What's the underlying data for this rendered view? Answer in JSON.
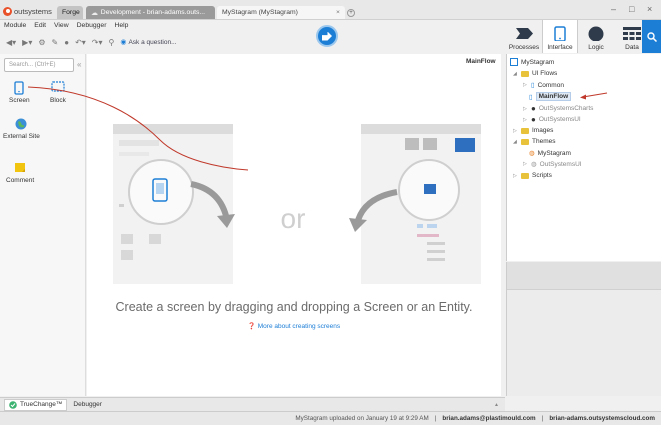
{
  "titlebar": {
    "brand": "outsystems",
    "tabs": [
      {
        "label": "Forge"
      },
      {
        "label": "Development - brian-adams.outs..."
      },
      {
        "label": "MyStagram (MyStagram)",
        "close": "×"
      }
    ],
    "add_tab": "+",
    "window_controls": {
      "minimize": "–",
      "maximize": "□",
      "close": "×"
    }
  },
  "menu": [
    "Module",
    "Edit",
    "View",
    "Debugger",
    "Help"
  ],
  "toolbar": {
    "ask": "Ask a question..."
  },
  "right_tabs": [
    {
      "label": "Processes",
      "icon": "processes-icon"
    },
    {
      "label": "Interface",
      "icon": "interface-icon",
      "active": true
    },
    {
      "label": "Logic",
      "icon": "logic-icon"
    },
    {
      "label": "Data",
      "icon": "data-icon"
    }
  ],
  "left_panel": {
    "search_placeholder": "Search... (Ctrl+E)",
    "widgets": [
      "Screen",
      "Block",
      "External Site",
      "Comment"
    ]
  },
  "canvas": {
    "flow_name": "MainFlow",
    "or_text": "or",
    "message": "Create a screen by dragging and dropping a Screen or an Entity.",
    "link": "More about creating screens"
  },
  "tree": {
    "root": "MyStagram",
    "ui_flows": "UI Flows",
    "common": "Common",
    "mainflow": "MainFlow",
    "charts": "OutSystemsCharts",
    "ui": "OutSystemsUI",
    "images": "Images",
    "themes": "Themes",
    "theme_mystagram": "MyStagram",
    "theme_ui": "OutSystemsUI",
    "scripts": "Scripts"
  },
  "bottom_tabs": [
    "TrueChange™",
    "Debugger"
  ],
  "status": {
    "upload": "MyStagram uploaded on January 19 at 9:29 AM",
    "user": "brian.adams@plastimould.com",
    "server": "brian-adams.outsystemscloud.com"
  },
  "colors": {
    "accent": "#1d7ed6",
    "brand": "#e8512a",
    "annotation": "#c0392b"
  }
}
